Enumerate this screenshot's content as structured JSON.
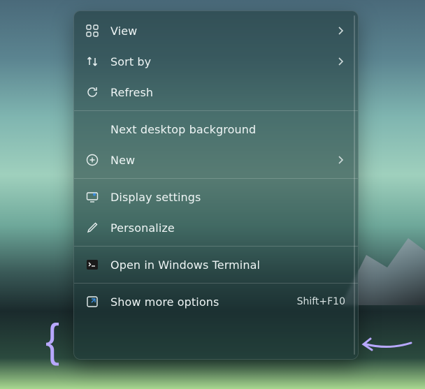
{
  "menu": {
    "items": [
      {
        "icon": "grid-icon",
        "label": "View",
        "submenu": true
      },
      {
        "icon": "sort-icon",
        "label": "Sort by",
        "submenu": true
      },
      {
        "icon": "refresh-icon",
        "label": "Refresh"
      },
      {
        "separator": true
      },
      {
        "icon": null,
        "label": "Next desktop background"
      },
      {
        "icon": "plus-icon",
        "label": "New",
        "submenu": true
      },
      {
        "separator": true
      },
      {
        "icon": "display-icon",
        "label": "Display settings"
      },
      {
        "icon": "pen-icon",
        "label": "Personalize"
      },
      {
        "separator": true
      },
      {
        "icon": "terminal-icon",
        "label": "Open in Windows Terminal"
      },
      {
        "separator": true
      },
      {
        "icon": "expand-icon",
        "label": "Show more options",
        "shortcut": "Shift+F10"
      }
    ]
  }
}
